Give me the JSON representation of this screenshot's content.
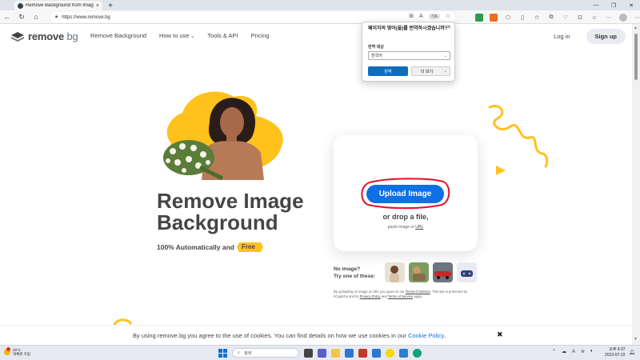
{
  "browser": {
    "tab_title": "Remove Background from Imag",
    "tab_close": "×",
    "new_tab": "+",
    "url": "https://www.remove.bg",
    "translate_chip": "가A"
  },
  "site": {
    "logo_remove": "remove",
    "logo_bg": "bg",
    "nav": [
      "Remove Background",
      "How to use",
      "Tools & API",
      "Pricing"
    ],
    "login": "Log in",
    "signup": "Sign up"
  },
  "hero": {
    "title_line1": "Remove Image",
    "title_line2": "Background",
    "subtitle": "100% Automatically and",
    "free_badge": "Free"
  },
  "upload": {
    "button": "Upload Image",
    "drop_text": "or drop a file,",
    "paste_prefix": "paste image or ",
    "paste_link": "URL"
  },
  "samples": {
    "no_image": "No image?",
    "try_one": "Try one of these:"
  },
  "terms": {
    "p1": "By uploading an image or URL you agree to our ",
    "link1": "Terms of Service",
    "p2": ". This site is protected by hCaptcha and its ",
    "link2": "Privacy Policy",
    "p3": " and ",
    "link3": "Terms of Service",
    "p4": " apply."
  },
  "cookie": {
    "text": "By using remove.bg you agree to the use of cookies. You can find details on how we use cookies in our ",
    "link": "Cookie Policy",
    "end": ".",
    "close": "✖"
  },
  "translate_popup": {
    "title": "페이지의 영어(을)를 번역하시겠습니까?",
    "label": "번역 대상",
    "language": "한국어",
    "translate_btn": "번역",
    "more_btn": "더 보기"
  },
  "taskbar": {
    "temp": "28°C",
    "weather": "대체로 흐림",
    "search_placeholder": "검색",
    "time": "오후 4:37",
    "date": "2023-07-22",
    "ime": "A"
  },
  "colors": {
    "brand_blue": "#0f70e6",
    "accent_yellow": "#ffc21d",
    "highlight_red": "#e0112b"
  }
}
